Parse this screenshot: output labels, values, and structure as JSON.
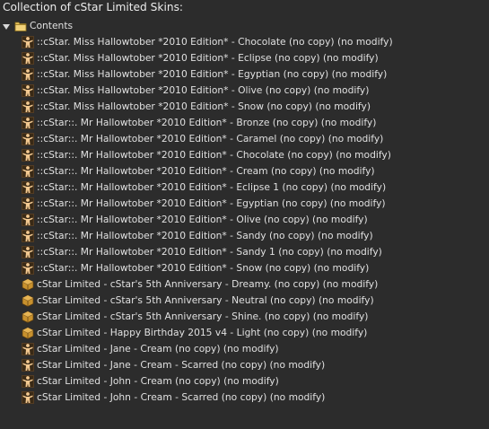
{
  "header": {
    "title": "Collection of cStar Limited Skins:"
  },
  "folder": {
    "label": "Contents",
    "expanded": true,
    "icon": "folder-icon"
  },
  "items": [
    {
      "label": "::cStar. Miss Hallowtober *2010 Edition*  - Chocolate (no copy) (no modify)",
      "icon": "body-shape"
    },
    {
      "label": "::cStar. Miss Hallowtober *2010 Edition*  - Eclipse (no copy) (no modify)",
      "icon": "body-shape"
    },
    {
      "label": "::cStar. Miss Hallowtober *2010 Edition*  - Egyptian (no copy) (no modify)",
      "icon": "body-shape"
    },
    {
      "label": "::cStar. Miss Hallowtober *2010 Edition*  - Olive (no copy) (no modify)",
      "icon": "body-shape"
    },
    {
      "label": "::cStar. Miss Hallowtober *2010 Edition*  - Snow (no copy) (no modify)",
      "icon": "body-shape"
    },
    {
      "label": "::cStar::. Mr Hallowtober *2010 Edition* - Bronze (no copy) (no modify)",
      "icon": "body-shape"
    },
    {
      "label": "::cStar::. Mr Hallowtober *2010 Edition* - Caramel (no copy) (no modify)",
      "icon": "body-shape"
    },
    {
      "label": "::cStar::. Mr Hallowtober *2010 Edition* - Chocolate (no copy) (no modify)",
      "icon": "body-shape"
    },
    {
      "label": "::cStar::. Mr Hallowtober *2010 Edition* - Cream (no copy) (no modify)",
      "icon": "body-shape"
    },
    {
      "label": "::cStar::. Mr Hallowtober *2010 Edition* - Eclipse 1 (no copy) (no modify)",
      "icon": "body-shape"
    },
    {
      "label": "::cStar::. Mr Hallowtober *2010 Edition* - Egyptian (no copy) (no modify)",
      "icon": "body-shape"
    },
    {
      "label": "::cStar::. Mr Hallowtober *2010 Edition* - Olive (no copy) (no modify)",
      "icon": "body-shape"
    },
    {
      "label": "::cStar::. Mr Hallowtober *2010 Edition* - Sandy (no copy) (no modify)",
      "icon": "body-shape"
    },
    {
      "label": "::cStar::. Mr Hallowtober *2010 Edition* - Sandy 1 (no copy) (no modify)",
      "icon": "body-shape"
    },
    {
      "label": "::cStar::. Mr Hallowtober *2010 Edition* - Snow (no copy) (no modify)",
      "icon": "body-shape"
    },
    {
      "label": "cStar Limited - cStar's 5th Anniversary - Dreamy. (no copy) (no modify)",
      "icon": "object-box"
    },
    {
      "label": "cStar Limited - cStar's 5th Anniversary - Neutral (no copy) (no modify)",
      "icon": "object-box"
    },
    {
      "label": "cStar Limited - cStar's 5th Anniversary - Shine. (no copy) (no modify)",
      "icon": "object-box"
    },
    {
      "label": "cStar Limited - Happy Birthday 2015 v4 - Light (no copy) (no modify)",
      "icon": "object-box"
    },
    {
      "label": "cStar Limited - Jane - Cream (no copy) (no modify)",
      "icon": "body-shape"
    },
    {
      "label": "cStar Limited - Jane - Cream - Scarred (no copy) (no modify)",
      "icon": "body-shape"
    },
    {
      "label": "cStar Limited - John - Cream (no copy) (no modify)",
      "icon": "body-shape"
    },
    {
      "label": "cStar Limited - John - Cream - Scarred (no copy) (no modify)",
      "icon": "body-shape"
    }
  ],
  "colors": {
    "background": "#2c2c2c",
    "text": "#e0e0e0",
    "folder": "#e8c45a",
    "skin_icon": "#e8b87a",
    "box_icon": "#c8912e"
  }
}
